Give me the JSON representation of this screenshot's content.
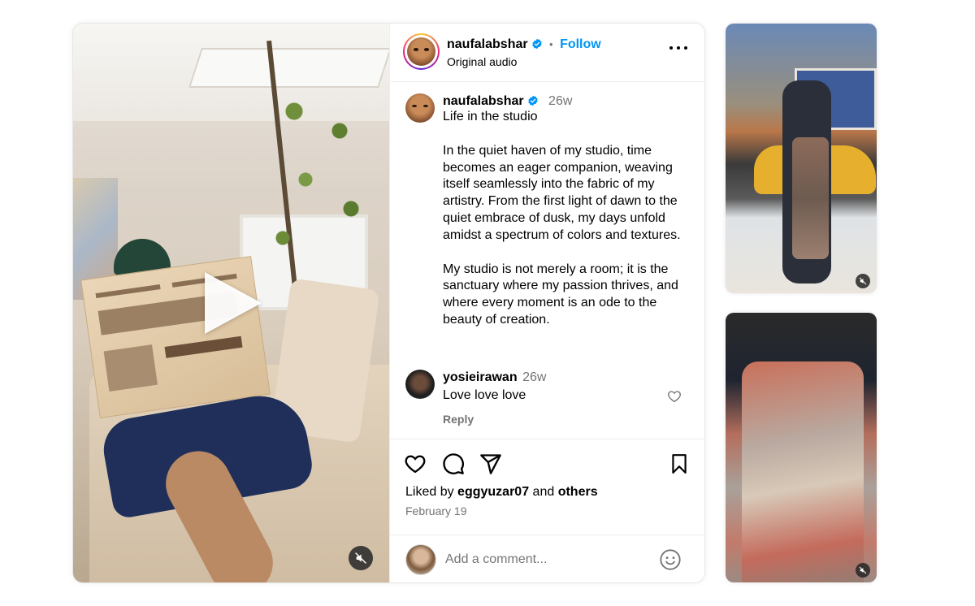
{
  "post": {
    "author": "naufalabshar",
    "separator": "•",
    "follow_label": "Follow",
    "audio": "Original audio"
  },
  "caption": {
    "author": "naufalabshar",
    "age": "26w",
    "title": "Life in the studio",
    "paragraph1": "In the quiet haven of my studio, time becomes an eager companion, weaving itself seamlessly into the fabric of my artistry. From the first light of dawn to the quiet embrace of dusk, my days unfold amidst a spectrum of colors and textures.",
    "paragraph2": "My studio is not merely a room; it is the sanctuary where my passion thrives, and where every moment is an ode to the beauty of creation."
  },
  "comment": {
    "author": "yosieirawan",
    "age": "26w",
    "text": "Love love love",
    "reply_label": "Reply"
  },
  "likes": {
    "prefix": "Liked by",
    "user": "eggyuzar07",
    "joiner": "and",
    "others": "others",
    "date": "February 19"
  },
  "composer": {
    "placeholder": "Add a comment..."
  },
  "colors": {
    "follow_blue": "#0095f6",
    "verified_blue": "#0095f6",
    "muted_text": "#737373"
  }
}
